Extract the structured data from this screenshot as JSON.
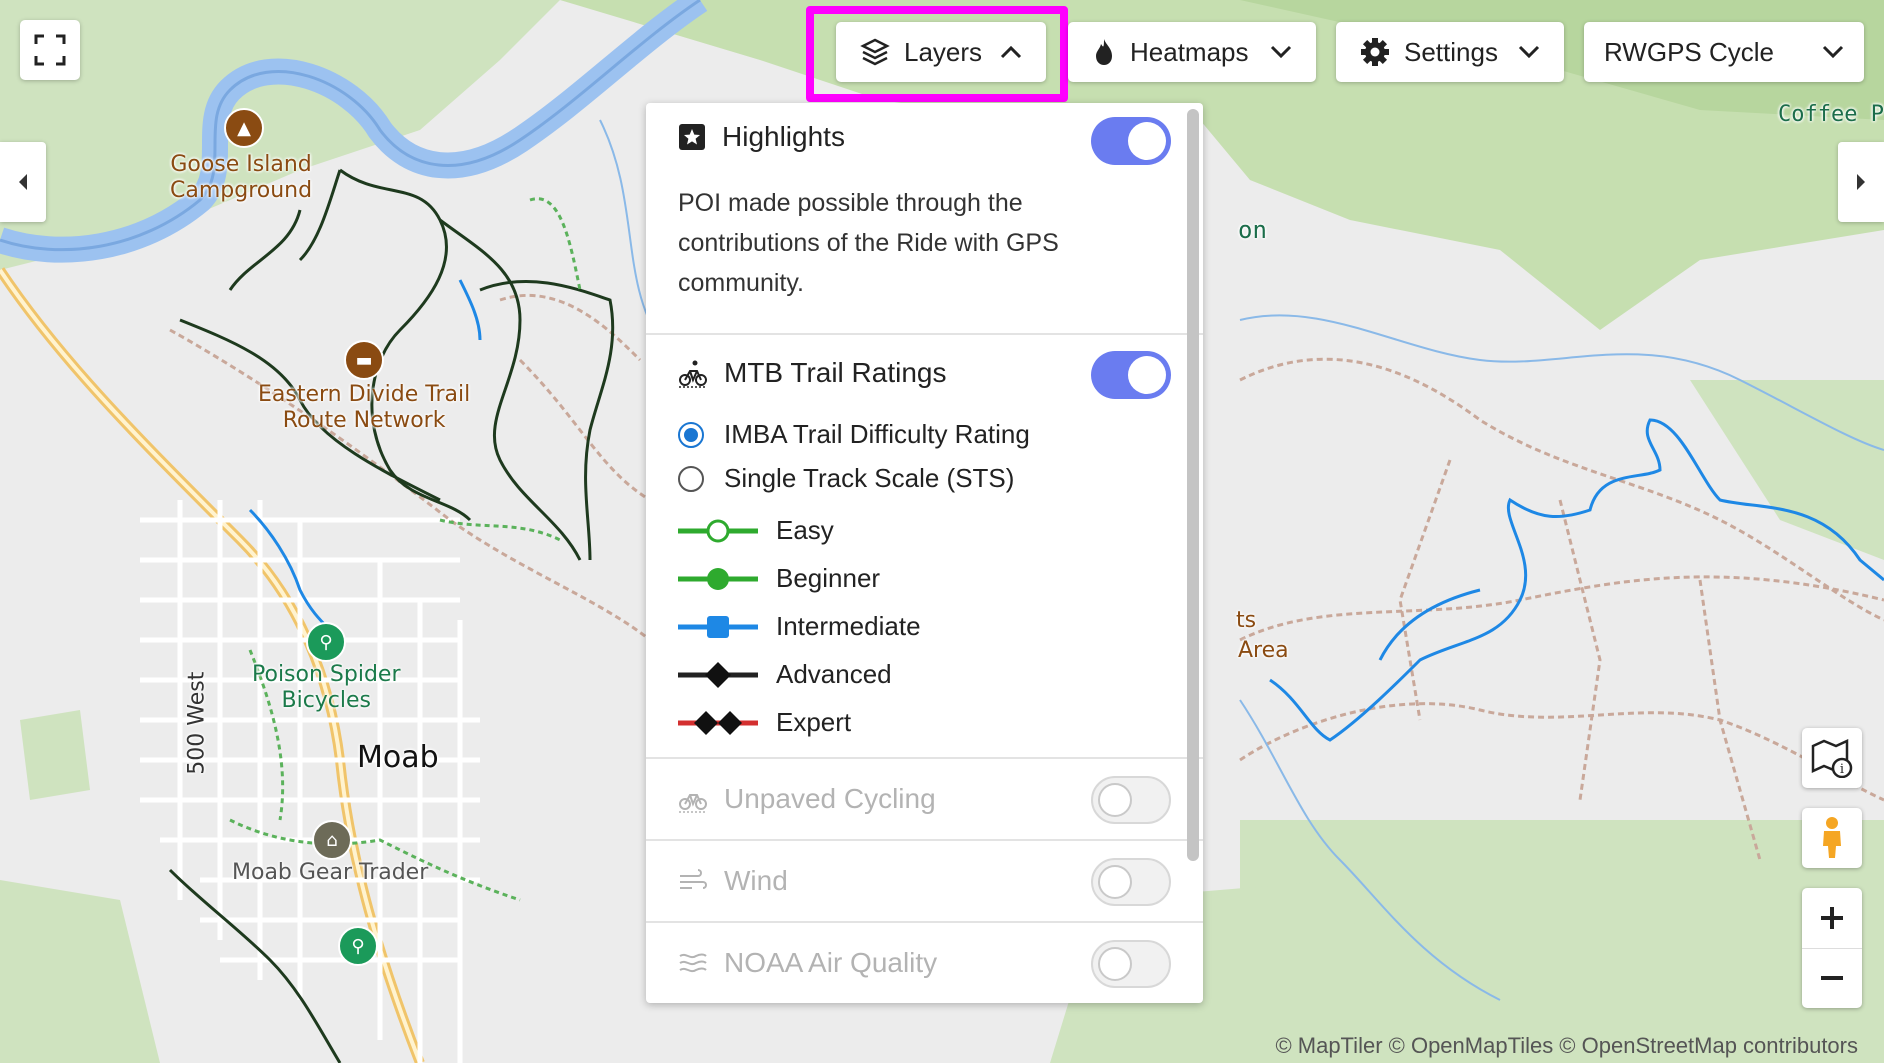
{
  "toolbar": {
    "layers_label": "Layers",
    "heatmaps_label": "Heatmaps",
    "settings_label": "Settings",
    "basemap_label": "RWGPS Cycle"
  },
  "colors": {
    "highlight_box": "#ff00ff",
    "toggle_on": "#6a7cf0",
    "radio_selected": "#1976d2",
    "easy": "#2eaa2e",
    "beginner": "#2eaa2e",
    "intermediate": "#1e88e5",
    "advanced": "#222222",
    "expert": "#d32f2f"
  },
  "layers_panel": {
    "highlights": {
      "title": "Highlights",
      "enabled": true,
      "description": "POI made possible through the contributions of the Ride with GPS community."
    },
    "mtb": {
      "title": "MTB Trail Ratings",
      "enabled": true,
      "options": [
        {
          "label": "IMBA Trail Difficulty Rating",
          "selected": true
        },
        {
          "label": "Single Track Scale (STS)",
          "selected": false
        }
      ],
      "legend": [
        {
          "label": "Easy",
          "marker": "open-circle"
        },
        {
          "label": "Beginner",
          "marker": "filled-circle"
        },
        {
          "label": "Intermediate",
          "marker": "square"
        },
        {
          "label": "Advanced",
          "marker": "diamond"
        },
        {
          "label": "Expert",
          "marker": "double-diamond"
        }
      ]
    },
    "unpaved": {
      "title": "Unpaved Cycling",
      "enabled": false
    },
    "wind": {
      "title": "Wind",
      "enabled": false
    },
    "air_quality": {
      "title": "NOAA Air Quality",
      "enabled": false
    }
  },
  "map": {
    "labels": {
      "goose_island": "Goose Island\nCampground",
      "eastern_divide": "Eastern Divide Trail\nRoute Network",
      "poison_spider": "Poison Spider\nBicycles",
      "moab": "Moab",
      "moab_gear": "Moab Gear Trader",
      "street_500_west": "500 West",
      "coffee": "Coffee P",
      "partial_on": "on",
      "partial_ts": "ts",
      "partial_area": "Area"
    },
    "attribution": "© MapTiler © OpenMapTiles © OpenStreetMap contributors"
  }
}
